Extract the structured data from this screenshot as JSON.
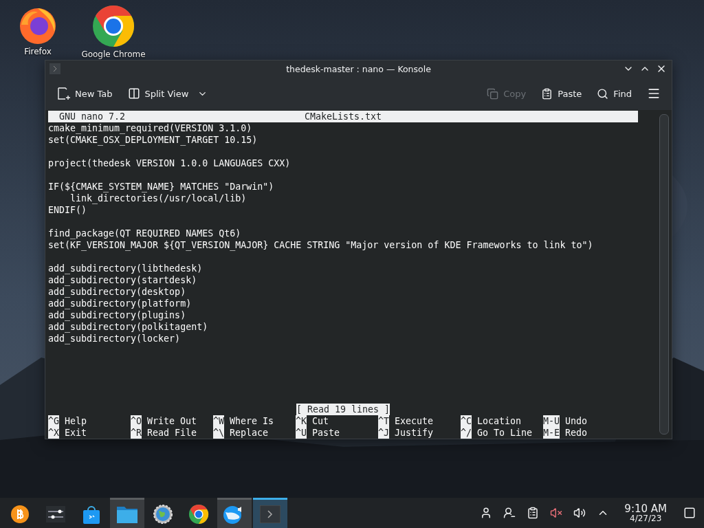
{
  "desktop_icons": [
    {
      "label": "Firefox",
      "kind": "firefox"
    },
    {
      "label": "Google Chrome",
      "kind": "chrome"
    }
  ],
  "window": {
    "title": "thedesk-master : nano — Konsole"
  },
  "toolbar": {
    "left": [
      {
        "label": "New Tab",
        "kind": "newtab"
      },
      {
        "label": "Split View",
        "kind": "split"
      }
    ],
    "right": [
      {
        "label": "Copy",
        "kind": "copy",
        "disabled": true
      },
      {
        "label": "Paste",
        "kind": "paste",
        "disabled": false
      },
      {
        "label": "Find",
        "kind": "find",
        "disabled": false
      }
    ]
  },
  "nano": {
    "version": "GNU nano 7.2",
    "filename": "CMakeLists.txt",
    "blocks": [
      [
        "cmake_minimum_required(VERSION 3.1.0)",
        "set(CMAKE_OSX_DEPLOYMENT_TARGET 10.15)"
      ],
      [
        "project(thedesk VERSION 1.0.0 LANGUAGES CXX)"
      ],
      [
        "IF(${CMAKE_SYSTEM_NAME} MATCHES \"Darwin\")",
        "    link_directories(/usr/local/lib)",
        "ENDIF()"
      ],
      [
        "find_package(QT REQUIRED NAMES Qt6)",
        "set(KF_VERSION_MAJOR ${QT_VERSION_MAJOR} CACHE STRING \"Major version of KDE Frameworks to link to\")"
      ],
      [
        "add_subdirectory(libthedesk)",
        "add_subdirectory(startdesk)",
        "add_subdirectory(desktop)",
        "add_subdirectory(platform)",
        "add_subdirectory(plugins)",
        "add_subdirectory(polkitagent)",
        "add_subdirectory(locker)"
      ]
    ],
    "status": "[ Read 19 lines ]",
    "shortcuts": [
      [
        {
          "key": "^G",
          "label": "Help"
        },
        {
          "key": "^O",
          "label": "Write Out"
        },
        {
          "key": "^W",
          "label": "Where Is"
        },
        {
          "key": "^K",
          "label": "Cut"
        },
        {
          "key": "^T",
          "label": "Execute"
        },
        {
          "key": "^C",
          "label": "Location"
        },
        {
          "key": "M-U",
          "label": "Undo"
        }
      ],
      [
        {
          "key": "^X",
          "label": "Exit"
        },
        {
          "key": "^R",
          "label": "Read File"
        },
        {
          "key": "^\\",
          "label": "Replace"
        },
        {
          "key": "^U",
          "label": "Paste"
        },
        {
          "key": "^J",
          "label": "Justify"
        },
        {
          "key": "^/",
          "label": "Go To Line"
        },
        {
          "key": "M-E",
          "label": "Redo"
        }
      ]
    ]
  },
  "taskbar": {
    "apps": [
      {
        "kind": "bitcoin",
        "open": false,
        "selected": false
      },
      {
        "kind": "mixer",
        "open": false,
        "selected": false
      },
      {
        "kind": "store",
        "open": false,
        "selected": false
      },
      {
        "kind": "files",
        "open": true,
        "selected": false
      },
      {
        "kind": "settings",
        "open": false,
        "selected": false
      },
      {
        "kind": "chrome",
        "open": false,
        "selected": false
      },
      {
        "kind": "globe",
        "open": true,
        "selected": false
      },
      {
        "kind": "terminal",
        "open": true,
        "selected": true
      }
    ],
    "tray": [
      {
        "kind": "user"
      },
      {
        "kind": "user-minus"
      },
      {
        "kind": "clipboard"
      },
      {
        "kind": "muted"
      },
      {
        "kind": "volume"
      },
      {
        "kind": "chevron"
      }
    ],
    "time": "9:10 AM",
    "date": "4/27/23"
  }
}
